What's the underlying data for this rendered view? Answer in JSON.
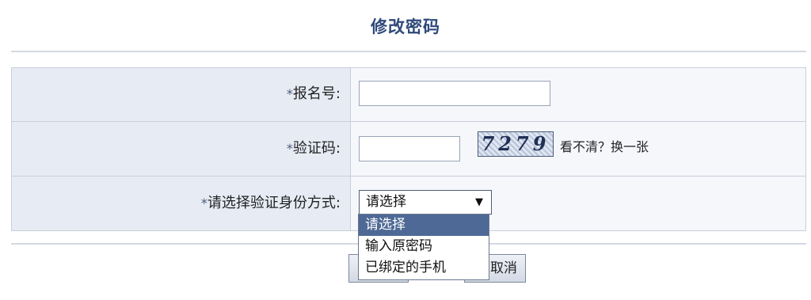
{
  "page": {
    "title": "修改密码"
  },
  "form": {
    "registration_no": {
      "star": "*",
      "label": "报名号:",
      "value": ""
    },
    "captcha": {
      "star": "*",
      "label": "验证码:",
      "value": "",
      "image_text": "7279",
      "refresh_text": "看不清？换一张"
    },
    "verify_method": {
      "star": "*",
      "label": "请选择验证身份方式:",
      "selected": "请选择",
      "arrow": "▼",
      "options": [
        "请选择",
        "输入原密码",
        "已绑定的手机"
      ]
    }
  },
  "buttons": {
    "cancel": "取消",
    "cancel_visible_fragment": "取消"
  },
  "colors": {
    "title": "#2e4a7a",
    "label_bg": "#e6ebf4",
    "option_highlight": "#4e6995"
  }
}
